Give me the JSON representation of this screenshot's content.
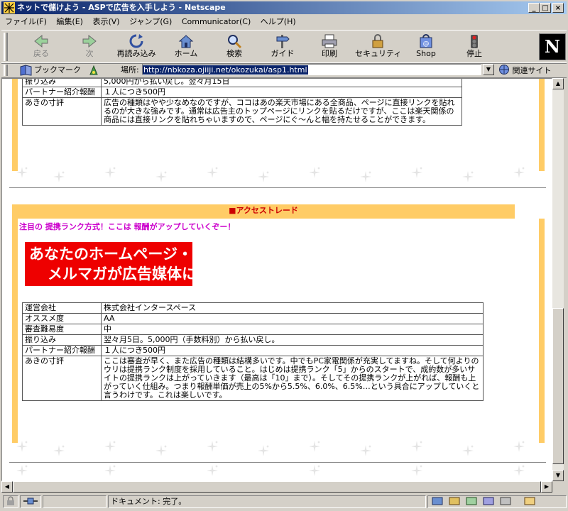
{
  "window": {
    "title": "ネットで儲けよう - ASPで広告を入手しよう - Netscape",
    "minimize_glyph": "_",
    "maximize_glyph": "□",
    "close_glyph": "×"
  },
  "menu": [
    "ファイル(F)",
    "編集(E)",
    "表示(V)",
    "ジャンプ(G)",
    "Communicator(C)",
    "ヘルプ(H)"
  ],
  "toolbar": {
    "buttons": [
      {
        "label": "戻る",
        "icon": "back-arrow-icon",
        "enabled": false
      },
      {
        "label": "次",
        "icon": "forward-arrow-icon",
        "enabled": false
      },
      {
        "label": "再読み込み",
        "icon": "reload-icon",
        "enabled": true
      },
      {
        "label": "ホーム",
        "icon": "home-icon",
        "enabled": true
      },
      {
        "label": "検索",
        "icon": "search-icon",
        "enabled": true
      },
      {
        "label": "ガイド",
        "icon": "guide-icon",
        "enabled": true
      },
      {
        "label": "印刷",
        "icon": "print-icon",
        "enabled": true
      },
      {
        "label": "セキュリティ",
        "icon": "lock-icon",
        "enabled": true
      },
      {
        "label": "Shop",
        "icon": "shop-icon",
        "enabled": true
      },
      {
        "label": "停止",
        "icon": "stop-icon",
        "enabled": true
      }
    ],
    "logo": "N"
  },
  "location": {
    "bookmarks_label": "ブックマーク",
    "location_label": "場所:",
    "url": "http://nbkoza.ojiiji.net/okozukai/asp1.html",
    "related_label": "関連サイト"
  },
  "content": {
    "top_table": [
      {
        "key": "振り込み",
        "value": "5,000円から払い戻し。翌々月15日"
      },
      {
        "key": "パートナー紹介報酬",
        "value": "１人につき500円"
      },
      {
        "key": "あきの寸評",
        "value": "広告の種類はやや少なめなのですが、ココはあの楽天市場にある全商品、ページに直接リンクを貼れるのが大きな強みです。通常は広告主のトップページにリンクを貼るだけですが、ここは楽天関係の商品には直接リンクを貼れちゃいますので、ページにぐ～んと幅を持たせることができます。"
      }
    ],
    "section2": {
      "heading": "■アクセストレード",
      "catch": "注目の 提携ランク方式！ここは 報酬がアップしていくぞー！",
      "banner_line1": "あなたのホームページ・",
      "banner_line2": "メルマガが広告媒体に！",
      "table": [
        {
          "key": "運営会社",
          "value": "株式会社インタースペース"
        },
        {
          "key": "オススメ度",
          "value": "AA"
        },
        {
          "key": "審査難易度",
          "value": "中"
        },
        {
          "key": "振り込み",
          "value": "翌々月5日。5,000円（手数料別）から払い戻し。"
        },
        {
          "key": "パートナー紹介報酬",
          "value": "１人につき500円"
        },
        {
          "key": "あきの寸評",
          "value": "ここは審査が早く、また広告の種類は結構多いです。中でもPC家電関係が充実してますね。そして何よりのウリは提携ランク制度を採用していること。はじめは提携ランク「5」からのスタートで、成約数が多いサイトの提携ランクは上がっていきます（最高は「10」まで）。そしてその提携ランクが上がれば、報酬も上がっていく仕組み。つまり報酬単価が売上の5%から5.5%、6.0%、6.5%…という具合にアップしていくと言うわけです。これは楽しいです。"
        }
      ]
    }
  },
  "status": {
    "text": "ドキュメント: 完了。"
  }
}
